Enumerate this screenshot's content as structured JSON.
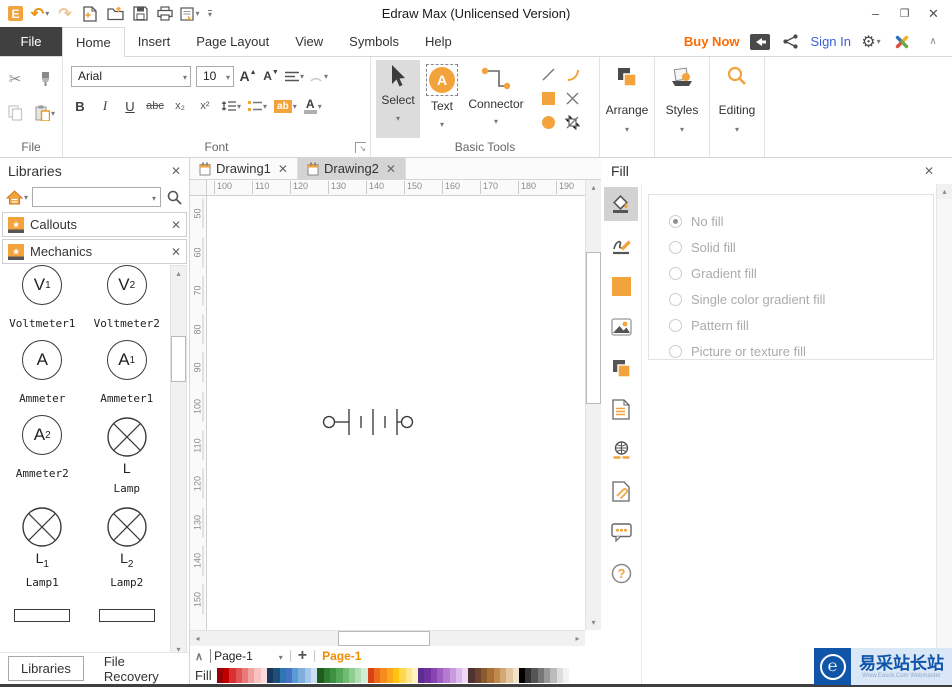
{
  "window": {
    "title": "Edraw Max (Unlicensed Version)"
  },
  "quick_access_icons": [
    "edraw-logo",
    "undo",
    "redo",
    "new-document",
    "open-file",
    "save",
    "print",
    "export-snapshot",
    "customize-toolbar"
  ],
  "menu": {
    "tabs": [
      "File",
      "Home",
      "Insert",
      "Page Layout",
      "View",
      "Symbols",
      "Help"
    ],
    "active_tab": "Home",
    "buy_now": "Buy Now",
    "sign_in": "Sign In",
    "right_icons": [
      "export-icon",
      "share-icon",
      "gear-icon",
      "edraw-x-logo-icon",
      "collapse-ribbon-icon"
    ]
  },
  "ribbon": {
    "file_group": {
      "label": "File",
      "icons": [
        "cut-icon",
        "format-painter-icon",
        "copy-icon",
        "paste-icon"
      ]
    },
    "font_group": {
      "label": "Font",
      "font_name": "Arial",
      "font_size": "10",
      "bold": "B",
      "italic": "I",
      "underline": "U",
      "strikethrough": "abc",
      "subscript": "x₂",
      "superscript": "x²",
      "highlight": "ab",
      "font_color": "A",
      "icons": [
        "grow-font-icon",
        "shrink-font-icon",
        "align-icon",
        "arc-text-icon",
        "line-spacing-icon",
        "bullets-icon",
        "highlight-icon",
        "font-color-icon"
      ]
    },
    "basic_tools": {
      "label": "Basic Tools",
      "select": "Select",
      "text": "Text",
      "connector": "Connector",
      "shape_icons": [
        "line-icon",
        "arc-icon",
        "rectangle-icon",
        "cross-icon",
        "ellipse-icon",
        "crop-icon"
      ]
    },
    "arrange": "Arrange",
    "styles": "Styles",
    "editing": "Editing"
  },
  "libraries": {
    "title": "Libraries",
    "search_placeholder": "",
    "sections": [
      {
        "label": "Callouts"
      },
      {
        "label": "Mechanics"
      }
    ],
    "symbols": [
      {
        "label": "Voltmeter1",
        "shape": "meter",
        "text": "V",
        "sub": "1"
      },
      {
        "label": "Voltmeter2",
        "shape": "meter",
        "text": "V",
        "sub": "2"
      },
      {
        "label": "Ammeter",
        "shape": "meter",
        "text": "A",
        "sub": ""
      },
      {
        "label": "Ammeter1",
        "shape": "meter",
        "text": "A",
        "sub": "1"
      },
      {
        "label": "Ammeter2",
        "shape": "meter",
        "text": "A",
        "sub": "2"
      },
      {
        "label": "Lamp",
        "shape": "lamp",
        "text": "L",
        "sub": ""
      },
      {
        "label": "Lamp1",
        "shape": "lamp",
        "text": "L",
        "sub": "1"
      },
      {
        "label": "Lamp2",
        "shape": "lamp",
        "text": "L",
        "sub": "2"
      },
      {
        "label": "",
        "shape": "rect",
        "text": "",
        "sub": ""
      },
      {
        "label": "",
        "shape": "rect",
        "text": "",
        "sub": ""
      }
    ],
    "bottom_tabs": [
      "Libraries",
      "File Recovery"
    ],
    "active_bottom_tab": "Libraries"
  },
  "canvas": {
    "doc_tabs": [
      {
        "label": "Drawing1"
      },
      {
        "label": "Drawing2"
      }
    ],
    "active_doc_tab": "Drawing2",
    "h_ruler": [
      "100",
      "110",
      "120",
      "130",
      "140",
      "150",
      "160",
      "170",
      "180",
      "190"
    ],
    "v_ruler": [
      "50",
      "60",
      "70",
      "80",
      "90",
      "100",
      "110",
      "120",
      "130",
      "140",
      "150"
    ],
    "shape_on_canvas": "battery-symbol"
  },
  "fill_panel": {
    "title": "Fill",
    "options": [
      "No fill",
      "Solid fill",
      "Gradient fill",
      "Single color gradient fill",
      "Pattern fill",
      "Picture or texture fill"
    ],
    "selected_option": "No fill",
    "side_icons": [
      "fill-icon",
      "line-style-icon",
      "shadow-icon",
      "picture-icon",
      "quick-style-icon",
      "page-setup-icon",
      "hyperlink-icon",
      "attachment-icon",
      "comment-icon",
      "help-icon"
    ]
  },
  "status_bar": {
    "page_selector": "Page-1",
    "page_tab": "Page-1",
    "fill_label": "Fill",
    "palette": [
      "#9C0006",
      "#C00000",
      "#D93030",
      "#E25555",
      "#EA7A7A",
      "#F19F9F",
      "#F7C2C2",
      "#FBDCDC",
      "#17375E",
      "#1F4E79",
      "#2E75B6",
      "#4472C4",
      "#5B9BD5",
      "#7FAEDC",
      "#A5C8EA",
      "#CBE0F4",
      "#1E5C1E",
      "#2E7D32",
      "#3F9142",
      "#54A857",
      "#70BC73",
      "#8FCD92",
      "#B0DDB2",
      "#D2EDD3",
      "#D84315",
      "#ED6A1F",
      "#F68C1E",
      "#FBA81A",
      "#FFC20E",
      "#FFD84D",
      "#FFE68C",
      "#FFF3C4",
      "#5B2D8E",
      "#7030A0",
      "#8844B0",
      "#9E5FC0",
      "#B47CCF",
      "#C89ADE",
      "#DCB9EC",
      "#EFD9F7",
      "#4E342E",
      "#6D4230",
      "#8A5A2B",
      "#A76F34",
      "#C08A4C",
      "#D2A877",
      "#E3C6A0",
      "#F1E2CC",
      "#000000",
      "#333333",
      "#555555",
      "#777777",
      "#999999",
      "#BBBBBB",
      "#DDDDDD",
      "#F2F2F2"
    ]
  },
  "watermark": {
    "text": "易采站长站",
    "subtext": "Www.Easck.Com Webmaster"
  },
  "colors": {
    "accent": "#F2A33C",
    "buy_now": "#FF6A00",
    "sign_in": "#3B5FD9",
    "file_tab_bg": "#404040",
    "active_doc_tab_bg": "#D4D4D4"
  }
}
